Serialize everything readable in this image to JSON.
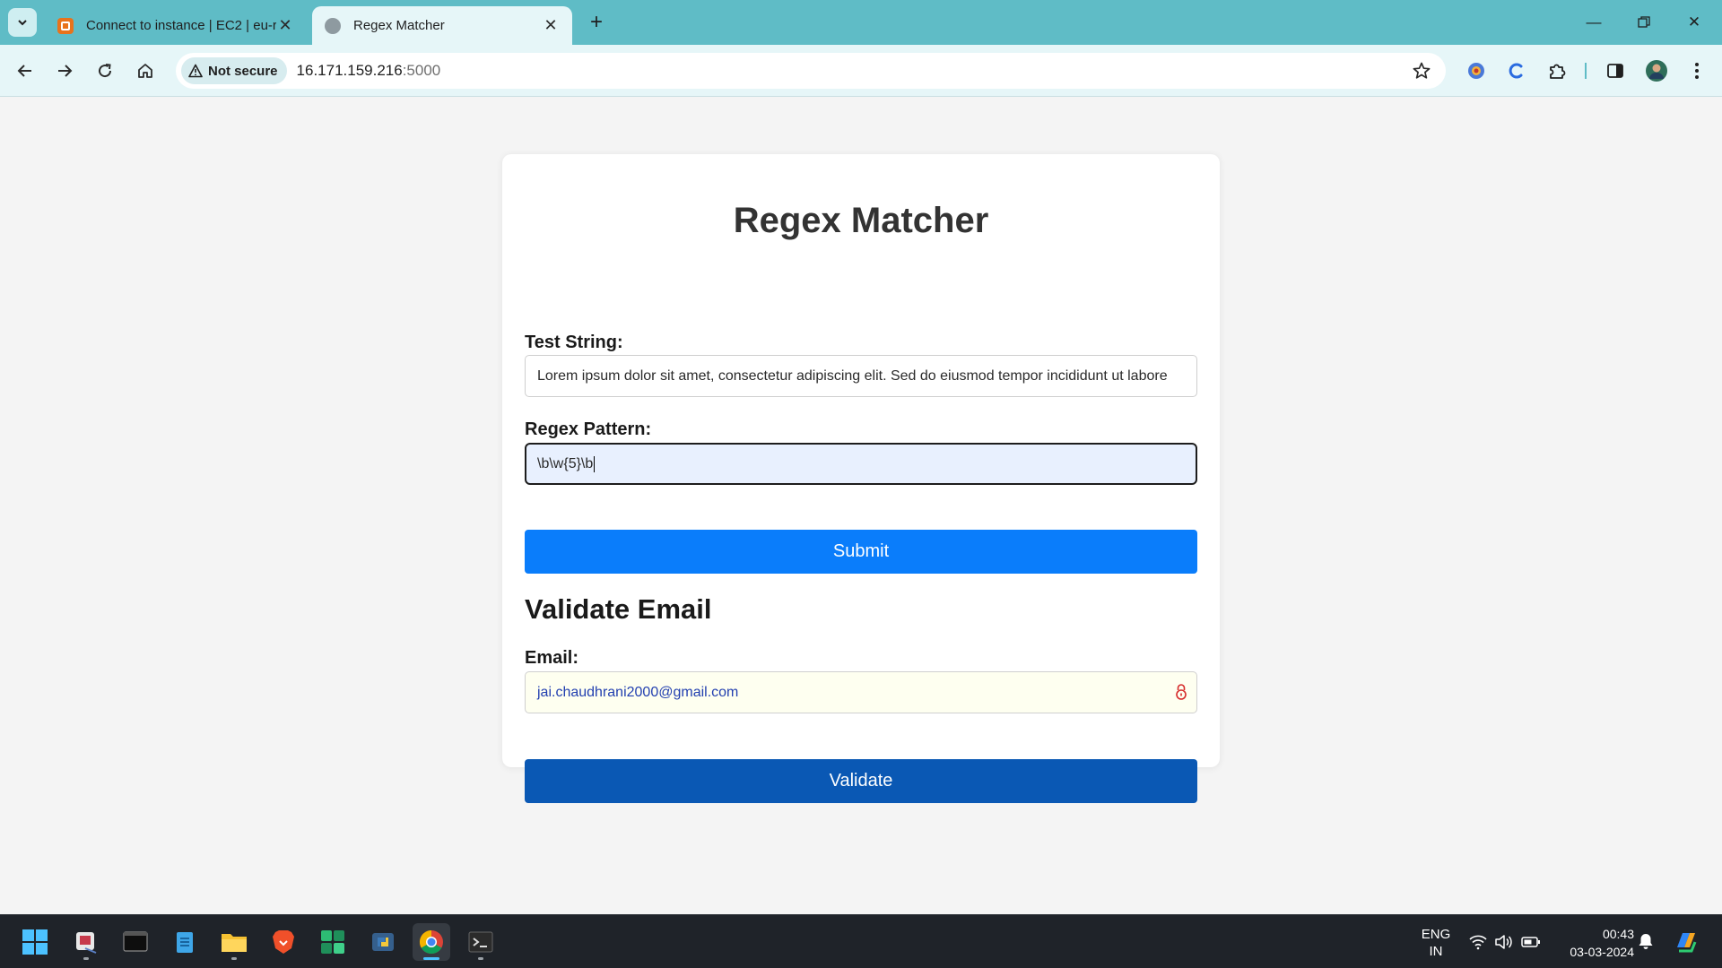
{
  "browser": {
    "tabs": [
      {
        "title": "Connect to instance | EC2 | eu-r",
        "active": false
      },
      {
        "title": "Regex Matcher",
        "active": true
      }
    ],
    "security_label": "Not secure",
    "url_host": "16.171.159.216",
    "url_port": ":5000"
  },
  "page": {
    "title": "Regex Matcher",
    "test_string_label": "Test String:",
    "test_string_value": "Lorem ipsum dolor sit amet, consectetur adipiscing elit. Sed do eiusmod tempor incididunt ut labore",
    "regex_label": "Regex Pattern:",
    "regex_value": "\\b\\w{5}\\b",
    "submit_label": "Submit",
    "validate_section_title": "Validate Email",
    "email_label": "Email:",
    "email_value": "jai.chaudhrani2000@gmail.com",
    "validate_label": "Validate"
  },
  "taskbar": {
    "lang_line1": "ENG",
    "lang_line2": "IN",
    "time": "00:43",
    "date": "03-03-2024"
  },
  "colors": {
    "tabbar": "#5fbcc6",
    "submit_button": "#0a7dfb",
    "validate_button": "#0a58b4",
    "page_background": "#f4f4f4"
  }
}
